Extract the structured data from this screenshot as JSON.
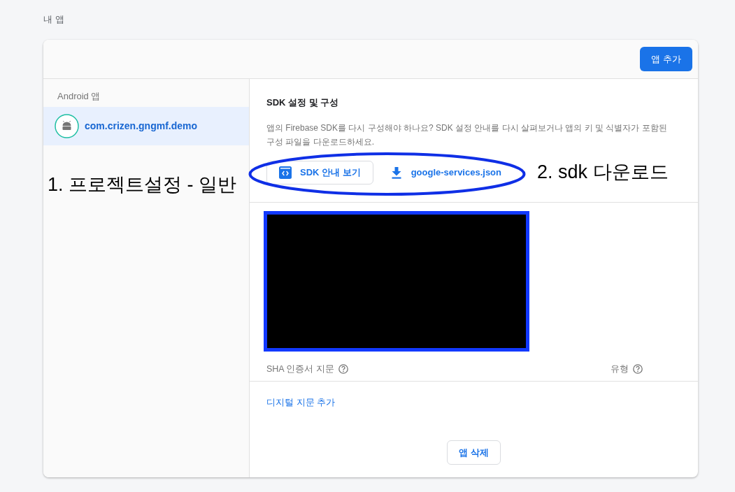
{
  "page": {
    "title": "내 앱"
  },
  "header": {
    "add_button": "앱 추가"
  },
  "sidebar": {
    "section_label": "Android 앱",
    "items": [
      {
        "name": "com.crizen.gngmf.demo",
        "selected": true
      }
    ]
  },
  "sdk_section": {
    "title": "SDK 설정 및 구성",
    "description": "앱의 Firebase SDK를 다시 구성해야 하나요? SDK 설정 안내를 다시 살펴보거나 앱의 키 및 식별자가 포함된 구성 파일을 다운로드하세요.",
    "buttons": [
      {
        "kind": "outlined",
        "label": "SDK 안내 보기"
      },
      {
        "kind": "text",
        "label": "google-services.json"
      }
    ]
  },
  "fingerprints": {
    "columns": [
      "SHA 인증서 지문",
      "유형"
    ],
    "add_link": "디지털 지문 추가"
  },
  "delete_button": "앱 삭제",
  "annotations": [
    {
      "text": "1. 프로젝트설정 - 일반"
    },
    {
      "text": "2. sdk 다운로드"
    }
  ]
}
